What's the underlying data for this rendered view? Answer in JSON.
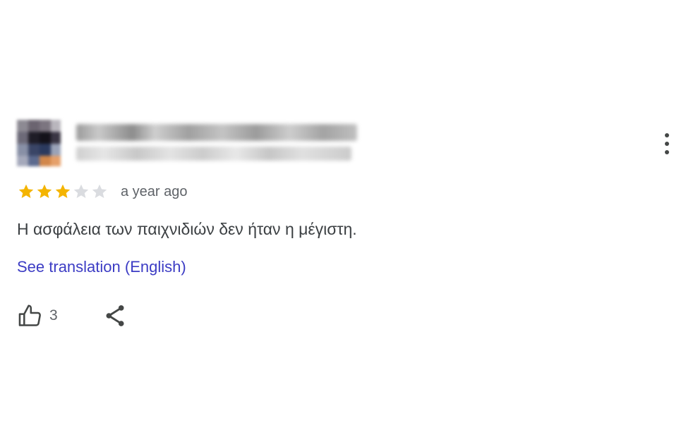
{
  "review": {
    "reviewer": {
      "name": "",
      "meta": ""
    },
    "rating": 3,
    "max_rating": 5,
    "timestamp": "a year ago",
    "text": "Η ασφάλεια των παιχνιδιών δεν ήταν η μέγιστη.",
    "translate_link": "See translation (English)",
    "like_count": "3"
  },
  "colors": {
    "star_filled": "#f4b400",
    "star_empty": "#dadce0",
    "link": "#3c3cc4",
    "text": "#3c4043",
    "muted": "#5f6368"
  },
  "icons": {
    "menu": "more-vert-icon",
    "like": "thumb-up-icon",
    "share": "share-icon",
    "star": "star-icon"
  }
}
